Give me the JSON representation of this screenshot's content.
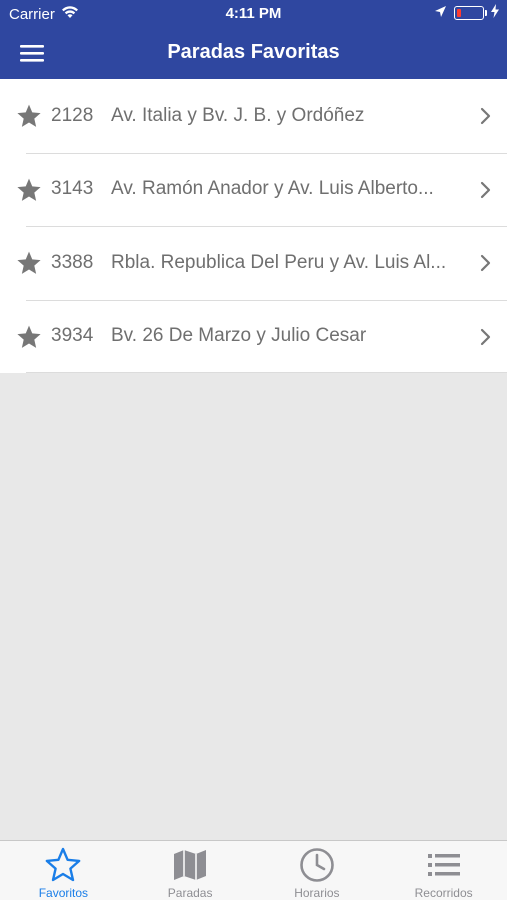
{
  "status_bar": {
    "carrier": "Carrier",
    "time": "4:11 PM"
  },
  "nav": {
    "title": "Paradas Favoritas"
  },
  "favorites": [
    {
      "code": "2128",
      "name": "Av. Italia y Bv. J. B. y Ordóñez"
    },
    {
      "code": "3143",
      "name": "Av. Ramón Anador y Av. Luis Alberto..."
    },
    {
      "code": "3388",
      "name": "Rbla. Republica Del Peru y Av. Luis Al..."
    },
    {
      "code": "3934",
      "name": "Bv. 26 De Marzo y Julio Cesar"
    }
  ],
  "tabs": [
    {
      "label": "Favoritos",
      "icon": "star-icon",
      "active": true
    },
    {
      "label": "Paradas",
      "icon": "map-icon",
      "active": false
    },
    {
      "label": "Horarios",
      "icon": "clock-icon",
      "active": false
    },
    {
      "label": "Recorridos",
      "icon": "list-icon",
      "active": false
    }
  ],
  "colors": {
    "nav_bg": "#2f47a0",
    "accent": "#1a7ee8",
    "inactive": "#8e8e93",
    "row_text": "#6f6f6f"
  }
}
